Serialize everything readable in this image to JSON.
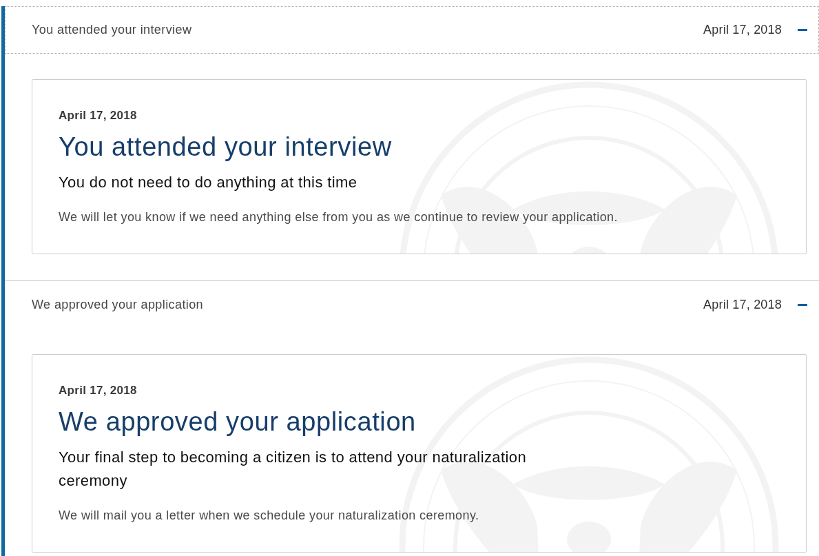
{
  "timeline": [
    {
      "heading": "You attended your interview",
      "date": "April 17, 2018",
      "expanded": true,
      "focused": true,
      "card": {
        "date": "April 17, 2018",
        "title": "You attended your interview",
        "subtitle": "You do not need to do anything at this time",
        "body": "We will let you know if we need anything else from you as we continue to review your application."
      }
    },
    {
      "heading": "We approved your application",
      "date": "April 17, 2018",
      "expanded": true,
      "focused": false,
      "card": {
        "date": "April 17, 2018",
        "title": "We approved your application",
        "subtitle": "Your final step to becoming a citizen is to attend your naturalization ceremony",
        "body": "We will mail you a letter when we schedule your naturalization ceremony."
      }
    }
  ]
}
